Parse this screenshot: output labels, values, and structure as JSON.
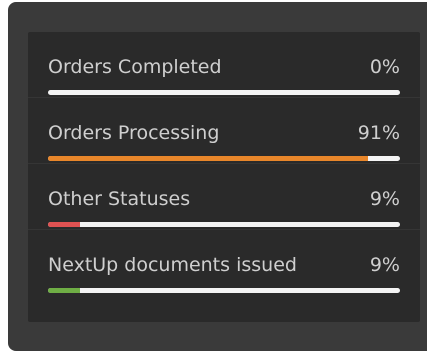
{
  "stats": [
    {
      "label": "Orders Completed",
      "value": "0%",
      "fraction": 0.0,
      "color": "#e8862a"
    },
    {
      "label": "Orders Processing",
      "value": "91%",
      "fraction": 0.91,
      "color": "#e8862a"
    },
    {
      "label": "Other Statuses",
      "value": "9%",
      "fraction": 0.09,
      "color": "#e05252"
    },
    {
      "label": "NextUp documents issued",
      "value": "9%",
      "fraction": 0.09,
      "color": "#6fae45"
    }
  ]
}
